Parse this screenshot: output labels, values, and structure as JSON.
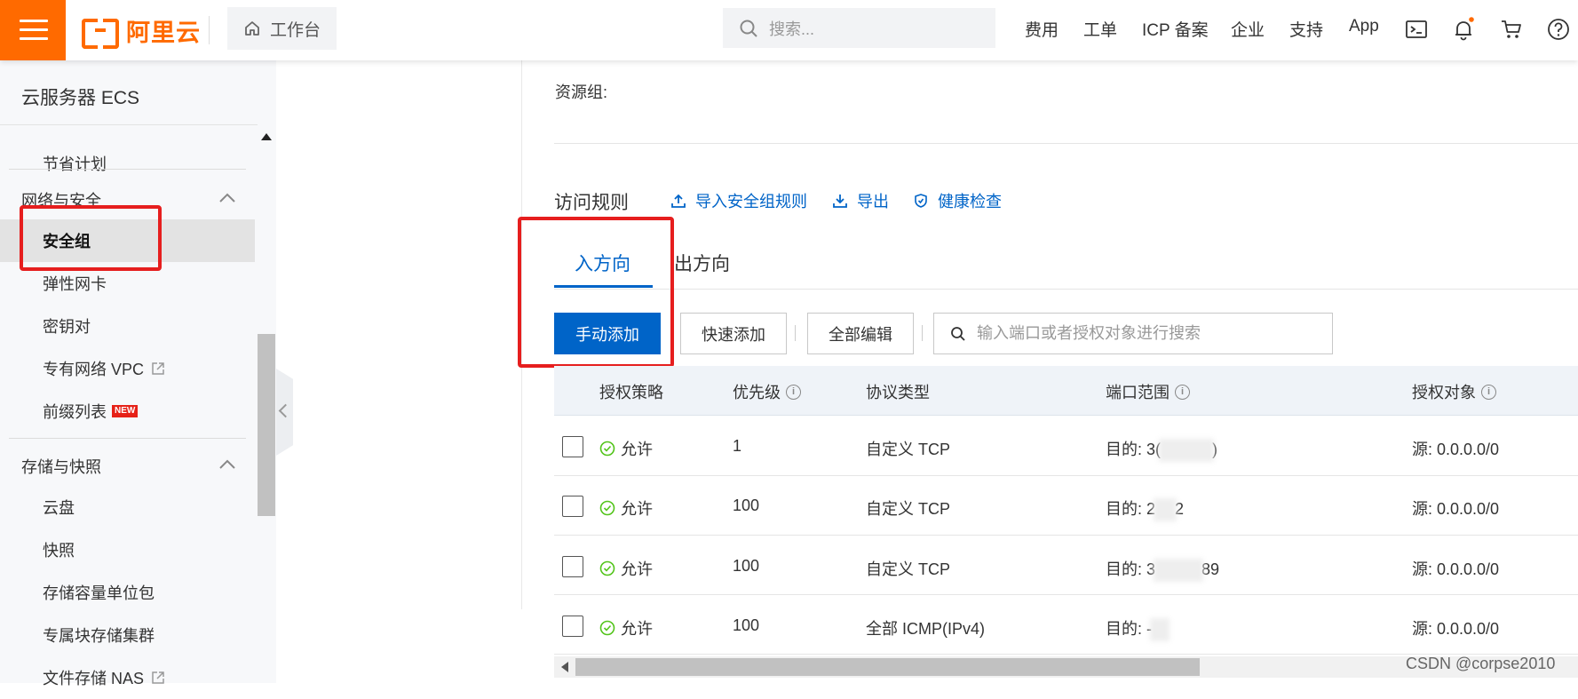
{
  "topbar": {
    "logo_text": "阿里云",
    "workbench": "工作台",
    "search_placeholder": "搜索...",
    "nav": [
      "费用",
      "工单",
      "ICP 备案",
      "企业",
      "支持",
      "App"
    ]
  },
  "sidebar": {
    "title": "云服务器 ECS",
    "items_top": [
      "节省计划"
    ],
    "group_network": "网络与安全",
    "network_items": [
      "安全组",
      "弹性网卡",
      "密钥对",
      "专有网络 VPC",
      "前缀列表"
    ],
    "new_badge": "NEW",
    "group_storage": "存储与快照",
    "storage_items": [
      "云盘",
      "快照",
      "存储容量单位包",
      "专属块存储集群",
      "文件存储 NAS"
    ]
  },
  "main": {
    "resource_group_label": "资源组:",
    "rules_title": "访问规则",
    "import_rules": "导入安全组规则",
    "export": "导出",
    "health_check": "健康检查",
    "tabs": [
      "入方向",
      "出方向"
    ],
    "buttons": {
      "manual_add": "手动添加",
      "quick_add": "快速添加",
      "edit_all": "全部编辑"
    },
    "rule_search_placeholder": "输入端口或者授权对象进行搜索",
    "columns": [
      "授权策略",
      "优先级",
      "协议类型",
      "端口范围",
      "授权对象"
    ],
    "rows": [
      {
        "policy": "允许",
        "priority": "1",
        "protocol": "自定义 TCP",
        "port_prefix": "目的: 3(",
        "port_suffix": ")",
        "source": "源: 0.0.0.0/0"
      },
      {
        "policy": "允许",
        "priority": "100",
        "protocol": "自定义 TCP",
        "port_prefix": "目的: 2",
        "port_suffix": "2",
        "source": "源: 0.0.0.0/0"
      },
      {
        "policy": "允许",
        "priority": "100",
        "protocol": "自定义 TCP",
        "port_prefix": "目的: 3",
        "port_suffix": "89",
        "source": "源: 0.0.0.0/0"
      },
      {
        "policy": "允许",
        "priority": "100",
        "protocol": "全部 ICMP(IPv4)",
        "port_prefix": "目的: -",
        "port_suffix": "",
        "source": "源: 0.0.0.0/0"
      }
    ]
  },
  "watermark": "CSDN @corpse2010",
  "colors": {
    "brand": "#ff6a00",
    "primary": "#0064c8",
    "annotation": "#e61e1e",
    "allow_green": "#52c41a"
  }
}
